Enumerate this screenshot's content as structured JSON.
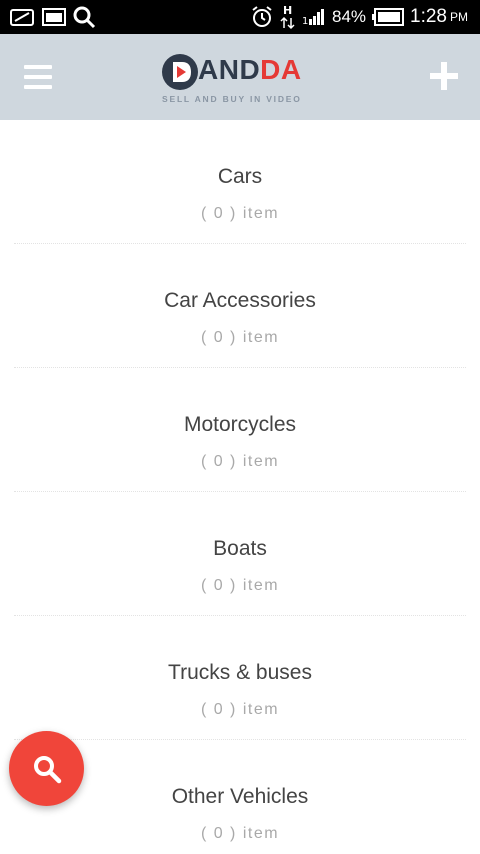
{
  "status_bar": {
    "battery_percent": "84%",
    "time": "1:28",
    "ampm": "PM"
  },
  "header": {
    "logo_text_dark": "AND",
    "logo_text_red": "DA",
    "logo_tagline": "SELL AND BUY IN VIDEO",
    "menu_icon": "hamburger-menu-icon",
    "add_icon": "plus-icon"
  },
  "categories": [
    {
      "name": "Cars",
      "count": "( 0 ) item"
    },
    {
      "name": "Car Accessories",
      "count": "( 0 ) item"
    },
    {
      "name": "Motorcycles",
      "count": "( 0 ) item"
    },
    {
      "name": "Boats",
      "count": "( 0 ) item"
    },
    {
      "name": "Trucks & buses",
      "count": "( 0 ) item"
    },
    {
      "name": "Other Vehicles",
      "count": "( 0 ) item"
    }
  ],
  "fab": {
    "icon": "search-icon",
    "color": "#f0453a"
  },
  "colors": {
    "header_bg": "#cfd7de",
    "brand_dark": "#2f3a4a",
    "brand_red": "#e53935"
  }
}
